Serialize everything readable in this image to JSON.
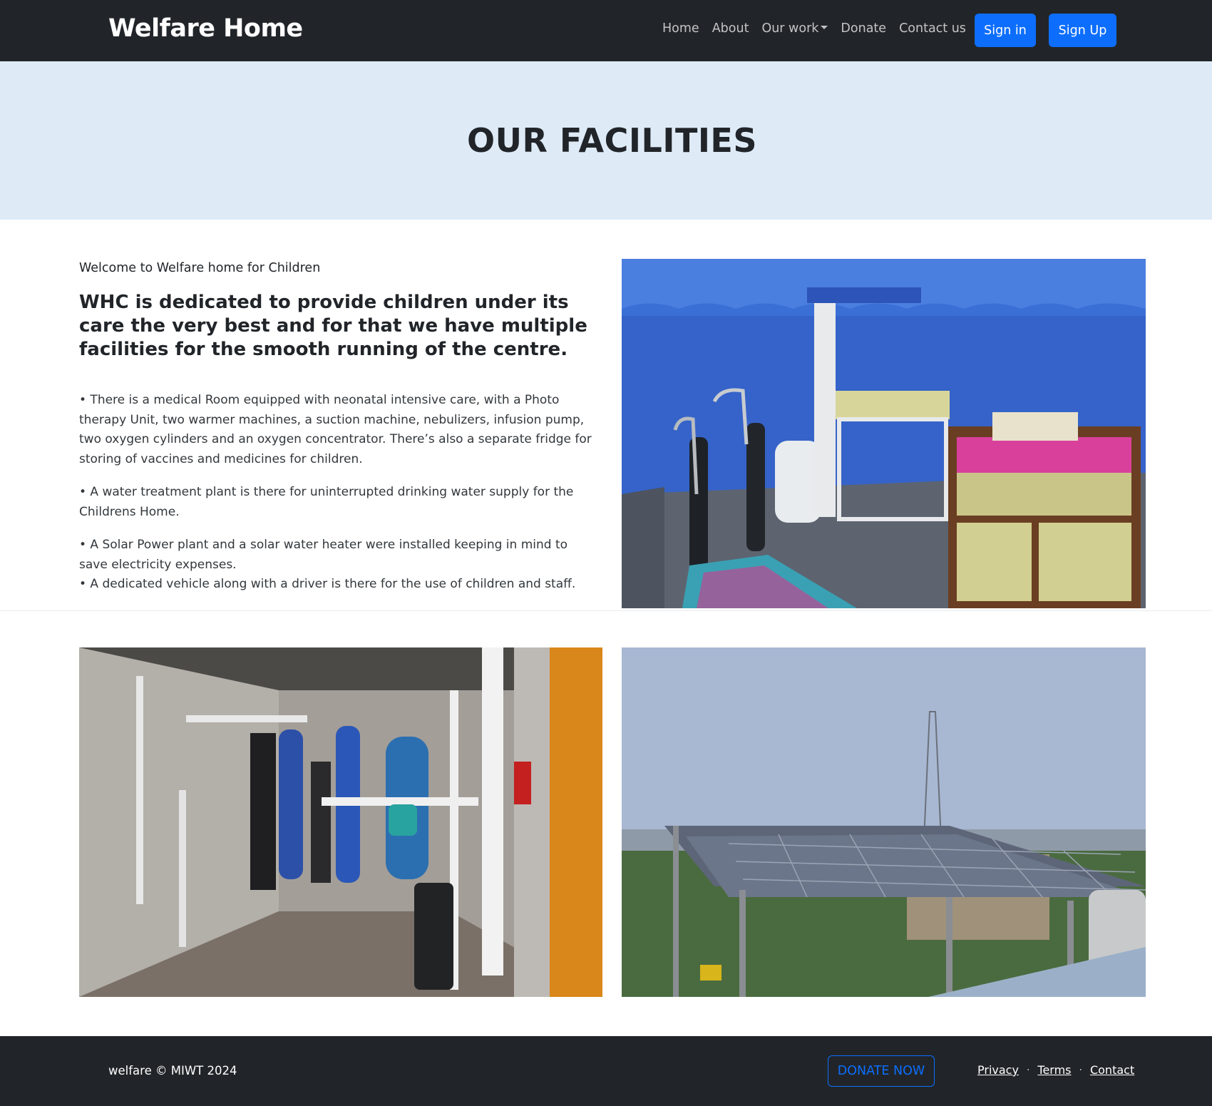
{
  "nav": {
    "brand": "Welfare Home",
    "links": [
      {
        "label": "Home"
      },
      {
        "label": "About"
      },
      {
        "label": "Our work",
        "dropdown": true
      },
      {
        "label": "Donate"
      },
      {
        "label": "Contact us"
      }
    ],
    "signin_label": "Sign in",
    "signup_label": "Sign Up"
  },
  "hero": {
    "title": "OUR FACILITIES"
  },
  "content": {
    "intro_label": "Welcome to Welfare home for Children",
    "heading": "WHC is dedicated to provide children under its care the very best and for that we have multiple facilities for the smooth running of the centre.",
    "bullets": [
      "• There is a medical Room equipped with neonatal intensive care, with a Photo therapy Unit, two warmer machines, a suction machine, nebulizers, infusion pump, two oxygen cylinders and an oxygen concentrator. There’s also a separate fridge for storing of vaccines and medicines for children.",
      "• A water treatment plant is there for uninterrupted drinking water supply for the Childrens Home.",
      "• A Solar Power plant and a solar water heater were installed keeping in mind to save electricity expenses.",
      "• A dedicated vehicle along with a driver is there for the use of children and staff."
    ]
  },
  "footer": {
    "copyright": "welfare © MIWT 2024",
    "donate_label": "DONATE NOW",
    "links": [
      "Privacy",
      "Terms",
      "Contact"
    ]
  },
  "colors": {
    "navbar_bg": "#212529",
    "hero_bg": "#deebf7",
    "primary": "#0d6efd"
  }
}
